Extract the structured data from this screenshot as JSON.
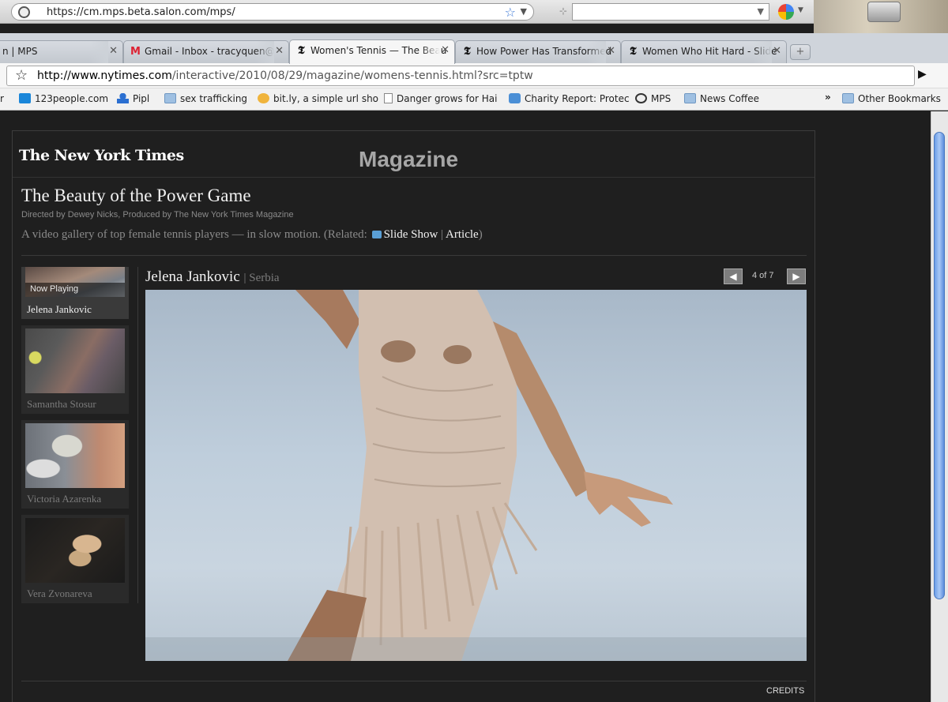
{
  "background_bar": {
    "url": "https://cm.mps.beta.salon.com/mps/"
  },
  "tabs": [
    {
      "label": "n | MPS",
      "icon": "salon-icon",
      "active": false
    },
    {
      "label": "Gmail - Inbox - tracyquen@",
      "icon": "gmail-icon",
      "active": false
    },
    {
      "label": "Women's Tennis — The Beau",
      "icon": "nyt-icon",
      "active": true
    },
    {
      "label": "How Power Has Transformed",
      "icon": "nyt-icon",
      "active": false
    },
    {
      "label": "Women Who Hit Hard - Slide",
      "icon": "nyt-icon",
      "active": false
    }
  ],
  "toolbar": {
    "url_host": "http://www.nytimes.com",
    "url_path": "/interactive/2010/08/29/magazine/womens-tennis.html?src=tptw"
  },
  "bookmarks": {
    "items": [
      {
        "label": "123people.com",
        "icon": "123people-icon"
      },
      {
        "label": "Pipl",
        "icon": "person-icon"
      },
      {
        "label": "sex trafficking",
        "icon": "folder-icon"
      },
      {
        "label": "bit.ly, a simple url sho",
        "icon": "bitly-icon"
      },
      {
        "label": "Danger grows for Hai",
        "icon": "document-icon"
      },
      {
        "label": "Charity Report: Protec",
        "icon": "charity-icon"
      },
      {
        "label": "MPS",
        "icon": "mps-icon"
      },
      {
        "label": "News Coffee",
        "icon": "folder-icon"
      }
    ],
    "more": "»",
    "other": "Other Bookmarks"
  },
  "page": {
    "logo": "The New York Times",
    "section": "Magazine",
    "title": "The Beauty of the Power Game",
    "byline": "Directed by Dewey Nicks, Produced by The New York Times Magazine",
    "description": "A video gallery of top female tennis players — in slow motion. (Related:",
    "link_slideshow": "Slide Show",
    "link_sep": "|",
    "link_article": "Article",
    "desc_end": ")",
    "now_playing": "Now Playing",
    "thumbnails": [
      {
        "name": "Jelena Jankovic",
        "current": true
      },
      {
        "name": "Samantha Stosur",
        "current": false
      },
      {
        "name": "Victoria Azarenka",
        "current": false
      },
      {
        "name": "Vera Zvonareva",
        "current": false
      }
    ],
    "player": {
      "name": "Jelena Jankovic",
      "country": "| Serbia",
      "counter": "4 of 7"
    },
    "credits": "CREDITS"
  }
}
